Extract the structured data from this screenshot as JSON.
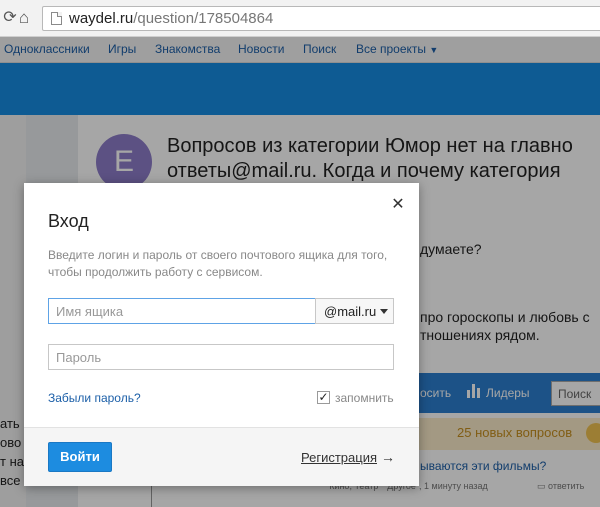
{
  "browser": {
    "url_host": "waydel.ru",
    "url_path": "/question/178504864"
  },
  "portal_nav": {
    "items": [
      "Одноклассники",
      "Игры",
      "Знакомства",
      "Новости",
      "Поиск",
      "Все проекты"
    ]
  },
  "question": {
    "avatar_letter": "E",
    "title_line1": "Вопросов из категории Юмор нет на главно",
    "title_line2": "ответы@mail.ru. Когда и почему категория",
    "bg_line1": "думаете?",
    "bg_line2": "про гороскопы и любовь с",
    "bg_line3": "тношениях рядом."
  },
  "left_fragments": [
    "ать",
    "ово",
    "т на",
    "все"
  ],
  "sidebar": {
    "tab_ask": "осить",
    "tab_leaders": "Лидеры",
    "search_placeholder": "Поиск",
    "new_questions": "25 новых вопросов",
    "item_title": "ываются эти фильмы?",
    "item_meta": "\"Кино, Театр\" \"Другое\", 1 минуту назад",
    "item_reply": "ответить"
  },
  "modal": {
    "title": "Вход",
    "description": "Введите логин и пароль от своего почтового ящика для того, чтобы продолжить работу с сервисом.",
    "login_placeholder": "Имя ящика",
    "domain": "@mail.ru",
    "password_placeholder": "Пароль",
    "forgot_password": "Забыли пароль?",
    "remember_label": "запомнить",
    "remember_checked": true,
    "login_button": "Войти",
    "register_link": "Регистрация",
    "register_arrow": "→"
  },
  "icons": {
    "refresh": "refresh-icon",
    "home": "home-icon",
    "page": "page-icon",
    "close": "close-icon",
    "caret": "chevron-down-icon",
    "leaders": "bar-chart-icon",
    "checkbox": "checkmark-icon"
  },
  "colors": {
    "brand_blue": "#168de2",
    "button_blue": "#1d8ce0",
    "link_blue": "#1c5fa8",
    "avatar_purple": "#8e7dc9",
    "new_questions_bg": "#fbecc9"
  }
}
